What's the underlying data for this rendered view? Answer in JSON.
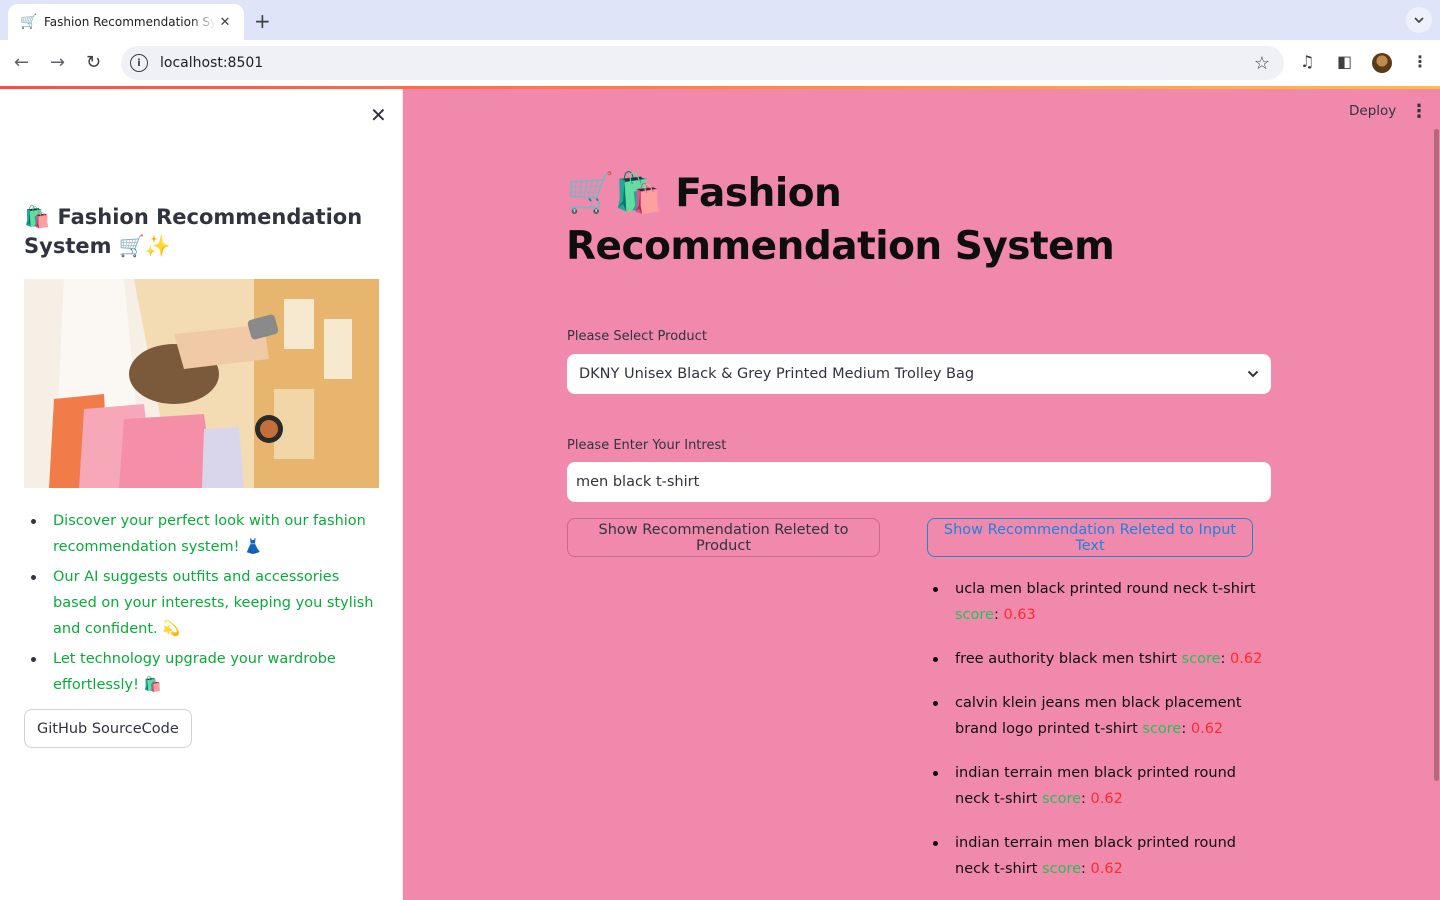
{
  "browser": {
    "tab_title": "Fashion Recommendation System",
    "tab_icon": "🛒",
    "new_tab": "+",
    "url": "localhost:8501"
  },
  "header": {
    "deploy_label": "Deploy"
  },
  "sidebar": {
    "close": "✕",
    "title": "🛍️ Fashion Recommendation System 🛒✨",
    "bullets": [
      "Discover your perfect look with our fashion recommendation system! 👗",
      "Our AI suggests outfits and accessories based on your interests, keeping you stylish and confident. 💫",
      "Let technology upgrade your wardrobe effortlessly! 🛍️"
    ],
    "github_button": "GitHub SourceCode"
  },
  "main": {
    "title": "🛒🛍️ Fashion Recommendation System",
    "select_label": "Please Select Product",
    "select_value": "DKNY Unisex Black & Grey Printed Medium Trolley Bag",
    "input_label": "Please Enter Your Intrest",
    "input_value": "men black t-shirt",
    "btn_product": "Show Recommendation Releted to Product",
    "btn_text": "Show Recommendation Releted to Input Text",
    "score_word": "score",
    "results": [
      {
        "name": "ucla men black printed round neck t-shirt",
        "score": "0.63"
      },
      {
        "name": "free authority black men tshirt",
        "score": "0.62"
      },
      {
        "name": "calvin klein jeans men black placement brand logo printed t-shirt",
        "score": "0.62"
      },
      {
        "name": "indian terrain men black printed round neck t-shirt",
        "score": "0.62"
      },
      {
        "name": "indian terrain men black printed round neck t-shirt",
        "score": "0.62"
      }
    ]
  },
  "colors": {
    "main_bg": "#f189ad",
    "score_word": "#21c354",
    "score_value": "#ff2b2b",
    "sidebar_text": "#09ab3b"
  },
  "icons": [
    "cart-favicon-icon",
    "close-tab-icon",
    "back-icon",
    "forward-icon",
    "reload-icon",
    "info-icon",
    "star-icon",
    "media-icon",
    "side-panel-icon",
    "profile-avatar",
    "menu-icon",
    "close-icon",
    "chevron-down-icon",
    "kebab-icon"
  ]
}
